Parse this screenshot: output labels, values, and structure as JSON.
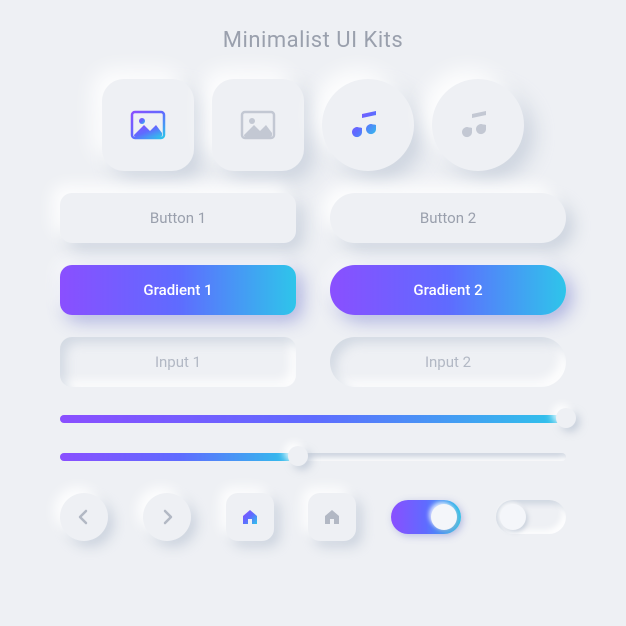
{
  "title": "Minimalist UI Kits",
  "icons": [
    {
      "name": "image-icon",
      "shape": "square",
      "style": "gradient"
    },
    {
      "name": "image-icon",
      "shape": "square",
      "style": "plain"
    },
    {
      "name": "music-icon",
      "shape": "circle",
      "style": "gradient"
    },
    {
      "name": "music-icon",
      "shape": "circle",
      "style": "plain"
    }
  ],
  "buttons": {
    "plain": [
      {
        "label": "Button 1",
        "shape": "rounded"
      },
      {
        "label": "Button 2",
        "shape": "pill"
      }
    ],
    "gradient": [
      {
        "label": "Gradient 1",
        "shape": "rounded"
      },
      {
        "label": "Gradient 2",
        "shape": "pill"
      }
    ]
  },
  "inputs": [
    {
      "placeholder": "Input 1"
    },
    {
      "placeholder": "Input 2"
    }
  ],
  "sliders": [
    {
      "value": 100
    },
    {
      "value": 47
    }
  ],
  "controls": [
    {
      "name": "prev-button",
      "type": "chevron-left",
      "shape": "circle"
    },
    {
      "name": "next-button",
      "type": "chevron-right",
      "shape": "circle"
    },
    {
      "name": "home-button",
      "type": "home",
      "shape": "square",
      "style": "gradient"
    },
    {
      "name": "home-button",
      "type": "home",
      "shape": "square",
      "style": "plain"
    }
  ],
  "toggles": [
    {
      "state": "on"
    },
    {
      "state": "off"
    }
  ],
  "colors": {
    "background": "#eef0f4",
    "text_muted": "#9aa0ad",
    "icon_muted": "#c3c8d3",
    "gradient_start": "#8a4fff",
    "gradient_mid": "#5f6bff",
    "gradient_end": "#2ec5ea"
  }
}
